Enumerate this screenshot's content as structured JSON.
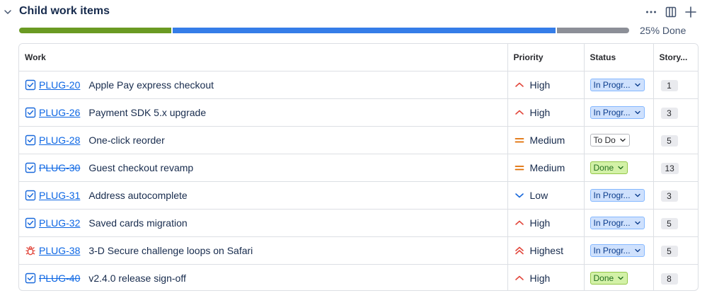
{
  "section": {
    "title": "Child work items",
    "progress_label": "25% Done",
    "progress": {
      "done": 0.25,
      "in_progress": 0.63,
      "todo": 0.12
    }
  },
  "columns": {
    "work": "Work",
    "priority": "Priority",
    "status": "Status",
    "story": "Story..."
  },
  "rows": [
    {
      "type": "task",
      "key": "PLUG-20",
      "struck": false,
      "summary": "Apple Pay express checkout",
      "priority": "High",
      "priority_icon": "priority-high-icon",
      "status": "In Progr...",
      "status_kind": "inprog",
      "points": "1"
    },
    {
      "type": "task",
      "key": "PLUG-26",
      "struck": false,
      "summary": "Payment SDK 5.x upgrade",
      "priority": "High",
      "priority_icon": "priority-high-icon",
      "status": "In Progr...",
      "status_kind": "inprog",
      "points": "3"
    },
    {
      "type": "task",
      "key": "PLUG-28",
      "struck": false,
      "summary": "One-click reorder",
      "priority": "Medium",
      "priority_icon": "priority-medium-icon",
      "status": "To Do",
      "status_kind": "todo",
      "points": "5"
    },
    {
      "type": "task",
      "key": "PLUG-30",
      "struck": true,
      "summary": "Guest checkout revamp",
      "priority": "Medium",
      "priority_icon": "priority-medium-icon",
      "status": "Done",
      "status_kind": "done",
      "points": "13"
    },
    {
      "type": "task",
      "key": "PLUG-31",
      "struck": false,
      "summary": "Address autocomplete",
      "priority": "Low",
      "priority_icon": "priority-low-icon",
      "status": "In Progr...",
      "status_kind": "inprog",
      "points": "3"
    },
    {
      "type": "task",
      "key": "PLUG-32",
      "struck": false,
      "summary": "Saved cards migration",
      "priority": "High",
      "priority_icon": "priority-high-icon",
      "status": "In Progr...",
      "status_kind": "inprog",
      "points": "5"
    },
    {
      "type": "bug",
      "key": "PLUG-38",
      "struck": false,
      "summary": "3-D Secure challenge loops on Safari",
      "priority": "Highest",
      "priority_icon": "priority-highest-icon",
      "status": "In Progr...",
      "status_kind": "inprog",
      "points": "5"
    },
    {
      "type": "task",
      "key": "PLUG-40",
      "struck": true,
      "summary": "v2.4.0 release sign-off",
      "priority": "High",
      "priority_icon": "priority-high-icon",
      "status": "Done",
      "status_kind": "done",
      "points": "8"
    }
  ],
  "colors": {
    "done": "#6a9a23",
    "in_progress": "#357de8",
    "todo": "#8c8f97",
    "link": "#0c66e4"
  }
}
